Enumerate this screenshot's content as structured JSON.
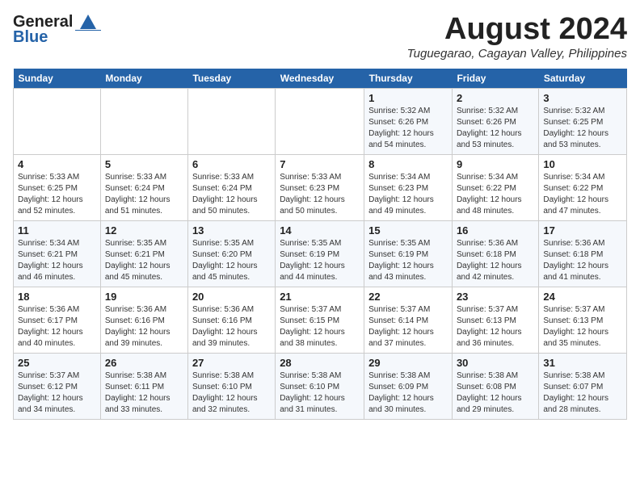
{
  "logo": {
    "general": "General",
    "blue": "Blue"
  },
  "header": {
    "month_year": "August 2024",
    "location": "Tuguegarao, Cagayan Valley, Philippines"
  },
  "weekdays": [
    "Sunday",
    "Monday",
    "Tuesday",
    "Wednesday",
    "Thursday",
    "Friday",
    "Saturday"
  ],
  "weeks": [
    [
      {
        "day": "",
        "info": ""
      },
      {
        "day": "",
        "info": ""
      },
      {
        "day": "",
        "info": ""
      },
      {
        "day": "",
        "info": ""
      },
      {
        "day": "1",
        "info": "Sunrise: 5:32 AM\nSunset: 6:26 PM\nDaylight: 12 hours\nand 54 minutes."
      },
      {
        "day": "2",
        "info": "Sunrise: 5:32 AM\nSunset: 6:26 PM\nDaylight: 12 hours\nand 53 minutes."
      },
      {
        "day": "3",
        "info": "Sunrise: 5:32 AM\nSunset: 6:25 PM\nDaylight: 12 hours\nand 53 minutes."
      }
    ],
    [
      {
        "day": "4",
        "info": "Sunrise: 5:33 AM\nSunset: 6:25 PM\nDaylight: 12 hours\nand 52 minutes."
      },
      {
        "day": "5",
        "info": "Sunrise: 5:33 AM\nSunset: 6:24 PM\nDaylight: 12 hours\nand 51 minutes."
      },
      {
        "day": "6",
        "info": "Sunrise: 5:33 AM\nSunset: 6:24 PM\nDaylight: 12 hours\nand 50 minutes."
      },
      {
        "day": "7",
        "info": "Sunrise: 5:33 AM\nSunset: 6:23 PM\nDaylight: 12 hours\nand 50 minutes."
      },
      {
        "day": "8",
        "info": "Sunrise: 5:34 AM\nSunset: 6:23 PM\nDaylight: 12 hours\nand 49 minutes."
      },
      {
        "day": "9",
        "info": "Sunrise: 5:34 AM\nSunset: 6:22 PM\nDaylight: 12 hours\nand 48 minutes."
      },
      {
        "day": "10",
        "info": "Sunrise: 5:34 AM\nSunset: 6:22 PM\nDaylight: 12 hours\nand 47 minutes."
      }
    ],
    [
      {
        "day": "11",
        "info": "Sunrise: 5:34 AM\nSunset: 6:21 PM\nDaylight: 12 hours\nand 46 minutes."
      },
      {
        "day": "12",
        "info": "Sunrise: 5:35 AM\nSunset: 6:21 PM\nDaylight: 12 hours\nand 45 minutes."
      },
      {
        "day": "13",
        "info": "Sunrise: 5:35 AM\nSunset: 6:20 PM\nDaylight: 12 hours\nand 45 minutes."
      },
      {
        "day": "14",
        "info": "Sunrise: 5:35 AM\nSunset: 6:19 PM\nDaylight: 12 hours\nand 44 minutes."
      },
      {
        "day": "15",
        "info": "Sunrise: 5:35 AM\nSunset: 6:19 PM\nDaylight: 12 hours\nand 43 minutes."
      },
      {
        "day": "16",
        "info": "Sunrise: 5:36 AM\nSunset: 6:18 PM\nDaylight: 12 hours\nand 42 minutes."
      },
      {
        "day": "17",
        "info": "Sunrise: 5:36 AM\nSunset: 6:18 PM\nDaylight: 12 hours\nand 41 minutes."
      }
    ],
    [
      {
        "day": "18",
        "info": "Sunrise: 5:36 AM\nSunset: 6:17 PM\nDaylight: 12 hours\nand 40 minutes."
      },
      {
        "day": "19",
        "info": "Sunrise: 5:36 AM\nSunset: 6:16 PM\nDaylight: 12 hours\nand 39 minutes."
      },
      {
        "day": "20",
        "info": "Sunrise: 5:36 AM\nSunset: 6:16 PM\nDaylight: 12 hours\nand 39 minutes."
      },
      {
        "day": "21",
        "info": "Sunrise: 5:37 AM\nSunset: 6:15 PM\nDaylight: 12 hours\nand 38 minutes."
      },
      {
        "day": "22",
        "info": "Sunrise: 5:37 AM\nSunset: 6:14 PM\nDaylight: 12 hours\nand 37 minutes."
      },
      {
        "day": "23",
        "info": "Sunrise: 5:37 AM\nSunset: 6:13 PM\nDaylight: 12 hours\nand 36 minutes."
      },
      {
        "day": "24",
        "info": "Sunrise: 5:37 AM\nSunset: 6:13 PM\nDaylight: 12 hours\nand 35 minutes."
      }
    ],
    [
      {
        "day": "25",
        "info": "Sunrise: 5:37 AM\nSunset: 6:12 PM\nDaylight: 12 hours\nand 34 minutes."
      },
      {
        "day": "26",
        "info": "Sunrise: 5:38 AM\nSunset: 6:11 PM\nDaylight: 12 hours\nand 33 minutes."
      },
      {
        "day": "27",
        "info": "Sunrise: 5:38 AM\nSunset: 6:10 PM\nDaylight: 12 hours\nand 32 minutes."
      },
      {
        "day": "28",
        "info": "Sunrise: 5:38 AM\nSunset: 6:10 PM\nDaylight: 12 hours\nand 31 minutes."
      },
      {
        "day": "29",
        "info": "Sunrise: 5:38 AM\nSunset: 6:09 PM\nDaylight: 12 hours\nand 30 minutes."
      },
      {
        "day": "30",
        "info": "Sunrise: 5:38 AM\nSunset: 6:08 PM\nDaylight: 12 hours\nand 29 minutes."
      },
      {
        "day": "31",
        "info": "Sunrise: 5:38 AM\nSunset: 6:07 PM\nDaylight: 12 hours\nand 28 minutes."
      }
    ]
  ]
}
